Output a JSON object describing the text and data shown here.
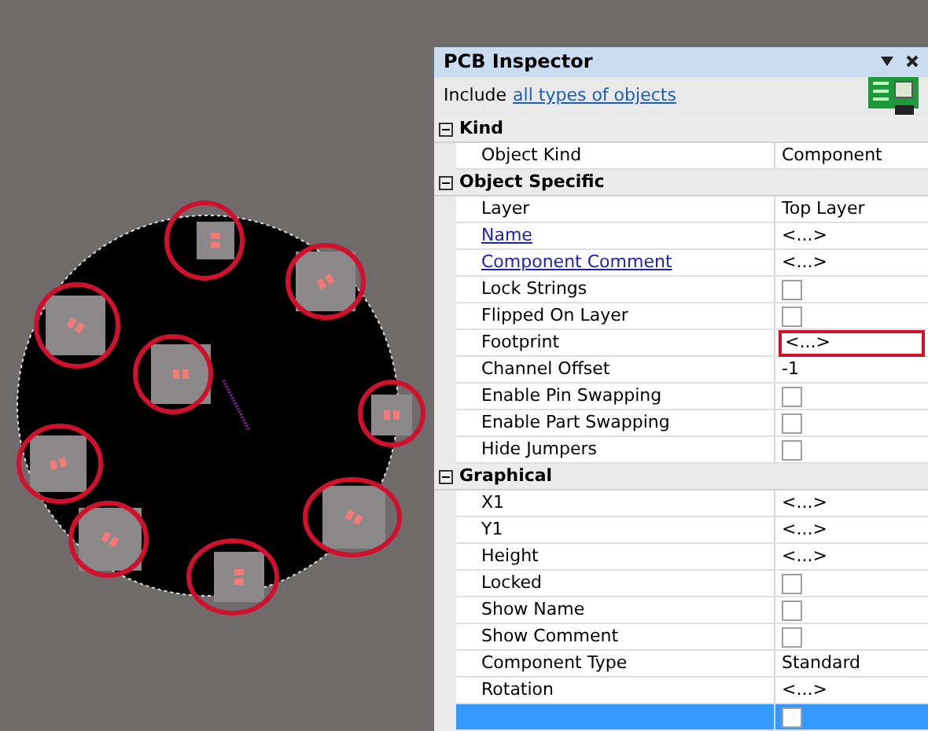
{
  "panel": {
    "title": "PCB Inspector",
    "include_label": "Include",
    "include_link": "all types of objects",
    "sections": [
      {
        "title": "Kind",
        "expanded": true,
        "rows": [
          {
            "label": "Object Kind",
            "kind": "text",
            "value": "Component",
            "link": false,
            "highlighted": false
          }
        ]
      },
      {
        "title": "Object Specific",
        "expanded": true,
        "rows": [
          {
            "label": "Layer",
            "kind": "text",
            "value": "Top Layer",
            "link": false,
            "highlighted": false
          },
          {
            "label": "Name",
            "kind": "text",
            "value": "<...>",
            "link": true,
            "highlighted": false
          },
          {
            "label": "Component Comment",
            "kind": "text",
            "value": "<...>",
            "link": true,
            "highlighted": false
          },
          {
            "label": "Lock Strings",
            "kind": "check",
            "checked": false,
            "link": false,
            "highlighted": false
          },
          {
            "label": "Flipped On Layer",
            "kind": "check",
            "checked": false,
            "link": false,
            "highlighted": false
          },
          {
            "label": "Footprint",
            "kind": "text",
            "value": "<...>",
            "link": false,
            "highlighted": true
          },
          {
            "label": "Channel Offset",
            "kind": "text",
            "value": "-1",
            "link": false,
            "highlighted": false
          },
          {
            "label": "Enable Pin Swapping",
            "kind": "check",
            "checked": false,
            "link": false,
            "highlighted": false
          },
          {
            "label": "Enable Part Swapping",
            "kind": "check",
            "checked": false,
            "link": false,
            "highlighted": false
          },
          {
            "label": "Hide Jumpers",
            "kind": "check",
            "checked": false,
            "link": false,
            "highlighted": false
          }
        ]
      },
      {
        "title": "Graphical",
        "expanded": true,
        "rows": [
          {
            "label": "X1",
            "kind": "text",
            "value": "<...>",
            "link": false,
            "highlighted": false
          },
          {
            "label": "Y1",
            "kind": "text",
            "value": "<...>",
            "link": false,
            "highlighted": false
          },
          {
            "label": "Height",
            "kind": "text",
            "value": "<...>",
            "link": false,
            "highlighted": false
          },
          {
            "label": "Locked",
            "kind": "check",
            "checked": false,
            "link": false,
            "highlighted": false
          },
          {
            "label": "Show Name",
            "kind": "check",
            "checked": false,
            "link": false,
            "highlighted": false
          },
          {
            "label": "Show Comment",
            "kind": "check",
            "checked": false,
            "link": false,
            "highlighted": false
          },
          {
            "label": "Component Type",
            "kind": "text",
            "value": "Standard",
            "link": false,
            "highlighted": false
          },
          {
            "label": "Rotation",
            "kind": "text",
            "value": "<...>",
            "link": false,
            "highlighted": false
          },
          {
            "kind": "check",
            "checked": false,
            "highlighted": false,
            "selected": true
          }
        ]
      }
    ]
  }
}
